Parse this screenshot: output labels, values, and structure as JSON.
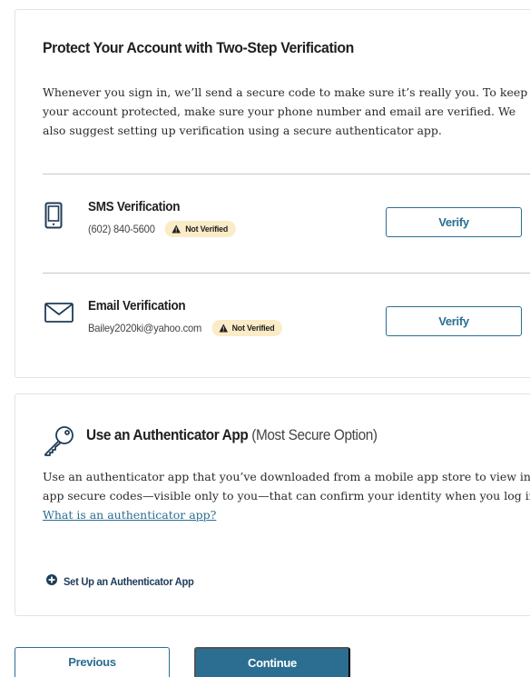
{
  "two_step": {
    "title": "Protect Your Account with Two-Step Verification",
    "intro": "Whenever you sign in, we’ll send a secure code to make sure it’s really you. To keep your account protected, make sure your phone number and email are verified. We also suggest setting up verification using a secure authenticator app.",
    "methods": [
      {
        "icon": "phone-icon",
        "title": "SMS Verification",
        "detail": "(602) 840-5600",
        "status": "Not Verified",
        "button_label": "Verify"
      },
      {
        "icon": "envelope-icon",
        "title": "Email Verification",
        "detail": "Bailey2020ki@yahoo.com",
        "status": "Not Verified",
        "button_label": "Verify"
      }
    ]
  },
  "authenticator": {
    "icon": "key-icon",
    "title": "Use an Authenticator App",
    "title_note": "(Most Secure Option)",
    "description": "Use an authenticator app that you’ve downloaded from a mobile app store to view in-app secure codes—visible only to you—that can confirm your identity when you log in.",
    "link_text": "What is an authenticator app?",
    "setup_label": "Set Up an Authenticator App"
  },
  "footer": {
    "previous_label": "Previous",
    "continue_label": "Continue"
  },
  "colors": {
    "accent": "#2b6e92",
    "badge_bg": "#fbecc7",
    "setup_text": "#1f3c58",
    "divider": "#c8c8c8"
  }
}
